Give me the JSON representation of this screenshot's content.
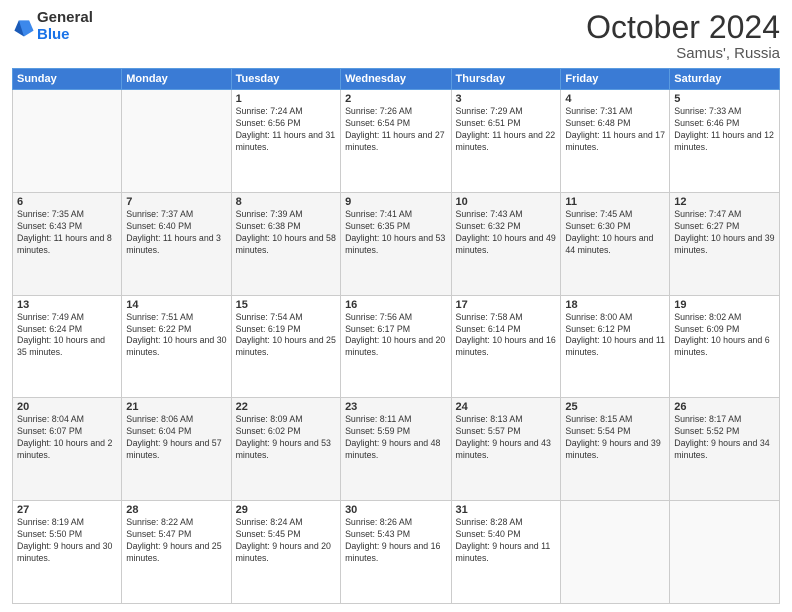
{
  "header": {
    "logo_general": "General",
    "logo_blue": "Blue",
    "month": "October 2024",
    "location": "Samus', Russia"
  },
  "weekdays": [
    "Sunday",
    "Monday",
    "Tuesday",
    "Wednesday",
    "Thursday",
    "Friday",
    "Saturday"
  ],
  "weeks": [
    [
      {
        "day": "",
        "info": ""
      },
      {
        "day": "",
        "info": ""
      },
      {
        "day": "1",
        "info": "Sunrise: 7:24 AM\nSunset: 6:56 PM\nDaylight: 11 hours and 31 minutes."
      },
      {
        "day": "2",
        "info": "Sunrise: 7:26 AM\nSunset: 6:54 PM\nDaylight: 11 hours and 27 minutes."
      },
      {
        "day": "3",
        "info": "Sunrise: 7:29 AM\nSunset: 6:51 PM\nDaylight: 11 hours and 22 minutes."
      },
      {
        "day": "4",
        "info": "Sunrise: 7:31 AM\nSunset: 6:48 PM\nDaylight: 11 hours and 17 minutes."
      },
      {
        "day": "5",
        "info": "Sunrise: 7:33 AM\nSunset: 6:46 PM\nDaylight: 11 hours and 12 minutes."
      }
    ],
    [
      {
        "day": "6",
        "info": "Sunrise: 7:35 AM\nSunset: 6:43 PM\nDaylight: 11 hours and 8 minutes."
      },
      {
        "day": "7",
        "info": "Sunrise: 7:37 AM\nSunset: 6:40 PM\nDaylight: 11 hours and 3 minutes."
      },
      {
        "day": "8",
        "info": "Sunrise: 7:39 AM\nSunset: 6:38 PM\nDaylight: 10 hours and 58 minutes."
      },
      {
        "day": "9",
        "info": "Sunrise: 7:41 AM\nSunset: 6:35 PM\nDaylight: 10 hours and 53 minutes."
      },
      {
        "day": "10",
        "info": "Sunrise: 7:43 AM\nSunset: 6:32 PM\nDaylight: 10 hours and 49 minutes."
      },
      {
        "day": "11",
        "info": "Sunrise: 7:45 AM\nSunset: 6:30 PM\nDaylight: 10 hours and 44 minutes."
      },
      {
        "day": "12",
        "info": "Sunrise: 7:47 AM\nSunset: 6:27 PM\nDaylight: 10 hours and 39 minutes."
      }
    ],
    [
      {
        "day": "13",
        "info": "Sunrise: 7:49 AM\nSunset: 6:24 PM\nDaylight: 10 hours and 35 minutes."
      },
      {
        "day": "14",
        "info": "Sunrise: 7:51 AM\nSunset: 6:22 PM\nDaylight: 10 hours and 30 minutes."
      },
      {
        "day": "15",
        "info": "Sunrise: 7:54 AM\nSunset: 6:19 PM\nDaylight: 10 hours and 25 minutes."
      },
      {
        "day": "16",
        "info": "Sunrise: 7:56 AM\nSunset: 6:17 PM\nDaylight: 10 hours and 20 minutes."
      },
      {
        "day": "17",
        "info": "Sunrise: 7:58 AM\nSunset: 6:14 PM\nDaylight: 10 hours and 16 minutes."
      },
      {
        "day": "18",
        "info": "Sunrise: 8:00 AM\nSunset: 6:12 PM\nDaylight: 10 hours and 11 minutes."
      },
      {
        "day": "19",
        "info": "Sunrise: 8:02 AM\nSunset: 6:09 PM\nDaylight: 10 hours and 6 minutes."
      }
    ],
    [
      {
        "day": "20",
        "info": "Sunrise: 8:04 AM\nSunset: 6:07 PM\nDaylight: 10 hours and 2 minutes."
      },
      {
        "day": "21",
        "info": "Sunrise: 8:06 AM\nSunset: 6:04 PM\nDaylight: 9 hours and 57 minutes."
      },
      {
        "day": "22",
        "info": "Sunrise: 8:09 AM\nSunset: 6:02 PM\nDaylight: 9 hours and 53 minutes."
      },
      {
        "day": "23",
        "info": "Sunrise: 8:11 AM\nSunset: 5:59 PM\nDaylight: 9 hours and 48 minutes."
      },
      {
        "day": "24",
        "info": "Sunrise: 8:13 AM\nSunset: 5:57 PM\nDaylight: 9 hours and 43 minutes."
      },
      {
        "day": "25",
        "info": "Sunrise: 8:15 AM\nSunset: 5:54 PM\nDaylight: 9 hours and 39 minutes."
      },
      {
        "day": "26",
        "info": "Sunrise: 8:17 AM\nSunset: 5:52 PM\nDaylight: 9 hours and 34 minutes."
      }
    ],
    [
      {
        "day": "27",
        "info": "Sunrise: 8:19 AM\nSunset: 5:50 PM\nDaylight: 9 hours and 30 minutes."
      },
      {
        "day": "28",
        "info": "Sunrise: 8:22 AM\nSunset: 5:47 PM\nDaylight: 9 hours and 25 minutes."
      },
      {
        "day": "29",
        "info": "Sunrise: 8:24 AM\nSunset: 5:45 PM\nDaylight: 9 hours and 20 minutes."
      },
      {
        "day": "30",
        "info": "Sunrise: 8:26 AM\nSunset: 5:43 PM\nDaylight: 9 hours and 16 minutes."
      },
      {
        "day": "31",
        "info": "Sunrise: 8:28 AM\nSunset: 5:40 PM\nDaylight: 9 hours and 11 minutes."
      },
      {
        "day": "",
        "info": ""
      },
      {
        "day": "",
        "info": ""
      }
    ]
  ]
}
